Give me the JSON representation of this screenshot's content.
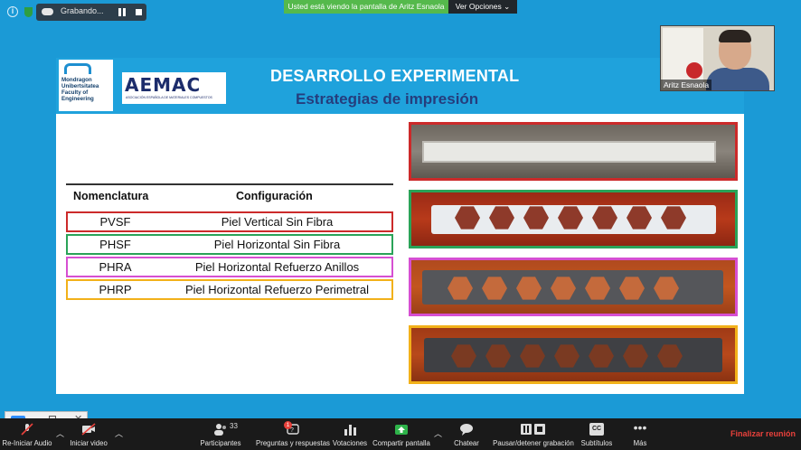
{
  "recording": {
    "label": "Grabando..."
  },
  "share_banner": {
    "viewing_text": "Usted está viendo la pantalla de Aritz Esnaola",
    "options_label": "Ver Opciones"
  },
  "slide": {
    "title": "DESARROLLO EXPERIMENTAL",
    "subtitle": "Estrategias de impresión",
    "logo_university": "Mondragon\nUnibertsitatea\nFaculty of\nEngineering",
    "logo_aemac": "AEMAC",
    "logo_aemac_sub": "ASOCIACIÓN ESPAÑOLA DE MATERIALES COMPUESTOS",
    "table": {
      "headers": [
        "Nomenclatura",
        "Configuración"
      ],
      "rows": [
        {
          "code": "PVSF",
          "config": "Piel Vertical Sin Fibra",
          "color": "#cc2a2a"
        },
        {
          "code": "PHSF",
          "config": "Piel Horizontal Sin Fibra",
          "color": "#2aa358"
        },
        {
          "code": "PHRA",
          "config": "Piel Horizontal Refuerzo Anillos",
          "color": "#d64fd2"
        },
        {
          "code": "PHRP",
          "config": "Piel Horizontal Refuerzo Perimetral",
          "color": "#f2b11a"
        }
      ]
    },
    "photos": [
      {
        "name": "PVSF sample",
        "border": "#cc2a2a"
      },
      {
        "name": "PHSF sample",
        "border": "#2aa358"
      },
      {
        "name": "PHRA sample",
        "border": "#d64fd2"
      },
      {
        "name": "PHRP sample",
        "border": "#f2b11a"
      }
    ]
  },
  "webcam": {
    "name": "Aritz Esnaola"
  },
  "toolbar": {
    "items": [
      {
        "label": "Re-Iniciar Audio",
        "icon": "microphone-muted-icon"
      },
      {
        "label": "Iniciar video",
        "icon": "video-off-icon"
      },
      {
        "label": "Participantes",
        "icon": "participants-icon",
        "count": "33"
      },
      {
        "label": "Preguntas y respuestas",
        "icon": "qa-icon",
        "badge": "1"
      },
      {
        "label": "Votaciones",
        "icon": "polls-icon"
      },
      {
        "label": "Compartir pantalla",
        "icon": "share-screen-icon"
      },
      {
        "label": "Chatear",
        "icon": "chat-icon"
      },
      {
        "label": "Pausar/detener grabación",
        "icon": "pause-stop-recording-icon"
      },
      {
        "label": "Subtítulos",
        "icon": "cc-icon",
        "icon_text": "CC"
      },
      {
        "label": "Más",
        "icon": "more-icon"
      }
    ],
    "end_label": "Finalizar reunión"
  }
}
